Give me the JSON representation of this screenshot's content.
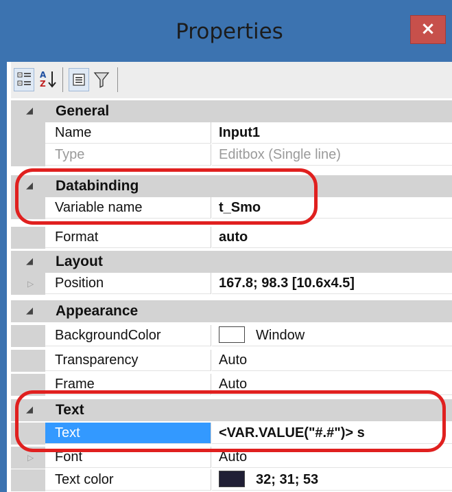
{
  "window": {
    "title": "Properties",
    "close_label": "×"
  },
  "toolbar": {
    "buttons": [
      {
        "icon": "categorized-icon",
        "active": true
      },
      {
        "icon": "alphabetical-sort-icon",
        "active": false
      },
      {
        "icon": "property-pages-icon",
        "active": true
      },
      {
        "icon": "filter-icon",
        "active": false
      }
    ]
  },
  "grid": {
    "general": {
      "label": "General",
      "name": {
        "label": "Name",
        "value": "Input1"
      },
      "type": {
        "label": "Type",
        "value": "Editbox (Single line)"
      }
    },
    "databinding": {
      "label": "Databinding",
      "variable_name": {
        "label": "Variable name",
        "value": "t_Smo"
      },
      "format": {
        "label": "Format",
        "value": "auto"
      }
    },
    "layout": {
      "label": "Layout",
      "position": {
        "label": "Position",
        "value": "167.8; 98.3 [10.6x4.5]"
      }
    },
    "appearance": {
      "label": "Appearance",
      "background_color": {
        "label": "BackgroundColor",
        "value": "Window",
        "swatch": "#ffffff"
      },
      "transparency": {
        "label": "Transparency",
        "value": "Auto"
      },
      "frame": {
        "label": "Frame",
        "value": "Auto"
      }
    },
    "text": {
      "label": "Text",
      "text": {
        "label": "Text",
        "value": "<VAR.VALUE(\"#.#\")> s"
      },
      "font": {
        "label": "Font",
        "value": "Auto"
      },
      "text_color": {
        "label": "Text color",
        "value": "32; 31; 53",
        "swatch": "#201f35"
      }
    }
  },
  "colors": {
    "accent": "#3c73b0",
    "selection": "#3399ff",
    "annotation": "#e0201f"
  }
}
